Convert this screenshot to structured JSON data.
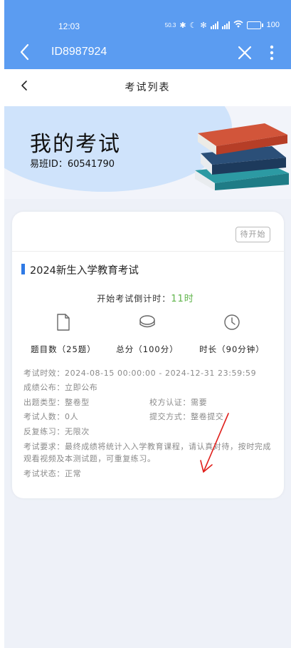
{
  "status_bar": {
    "time": "12:03",
    "net_speed": "50.3",
    "battery_pct": "100",
    "battery_level": 1.0
  },
  "title_bar": {
    "page_id": "ID8987924"
  },
  "nav": {
    "title": "考试列表"
  },
  "banner": {
    "title": "我的考试",
    "yiban_id": "易班ID：60541790"
  },
  "exam": {
    "status_label": "待开始",
    "name": "2024新生入学教育考试",
    "countdown_label": "开始考试倒计时：",
    "countdown_value": "11时",
    "stats": [
      {
        "icon": "document-icon",
        "label": "题目数（25题）"
      },
      {
        "icon": "coins-icon",
        "label": "总分（100分）"
      },
      {
        "icon": "clock-icon",
        "label": "时长（90分钟）"
      }
    ],
    "details": {
      "validity": "考试时效：2024-08-15 00:00:00 - 2024-12-31 23:59:59",
      "publish": "成绩公布：立即公布",
      "question_type": "出题类型：整卷型",
      "school_cert": "校方认证：需要",
      "participants": "考试人数：0人",
      "submit_mode": "提交方式：整卷提交",
      "practice": "反复练习：无限次",
      "requirement": "考试要求：最终成绩将统计入入学教育课程，请认真对待，按时完成观看视频及本测试题，可重复练习。",
      "exam_state": "考试状态：正常"
    }
  },
  "colors": {
    "header": "#5b9cf1",
    "accent": "#2f7ae5",
    "countdown": "#5fb44a",
    "annotation": "#e0201c"
  }
}
